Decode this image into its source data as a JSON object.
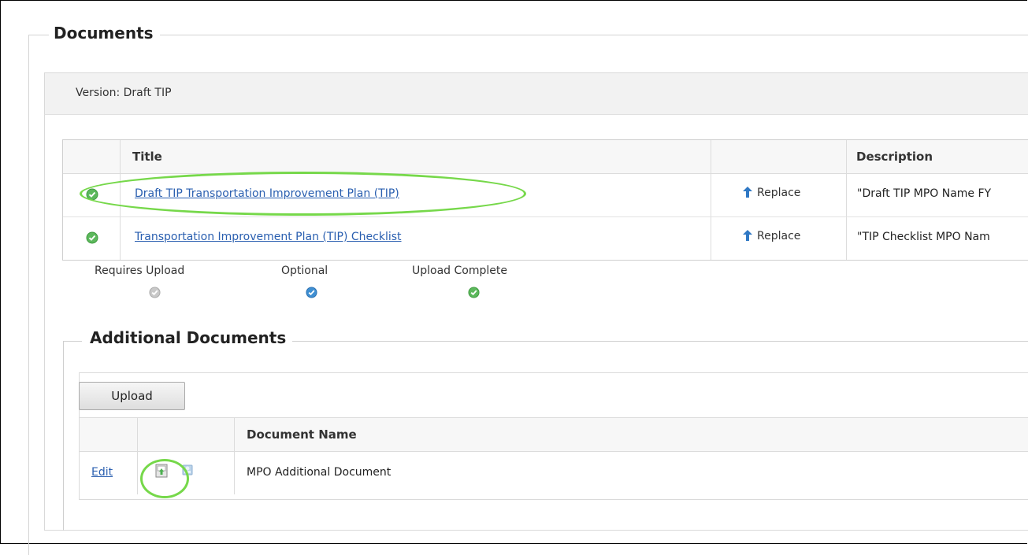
{
  "documents": {
    "legend": "Documents",
    "version_text": "Version: Draft TIP",
    "table": {
      "headers": {
        "title": "Title",
        "action": "",
        "description": "Description"
      },
      "rows": [
        {
          "status": "upload-complete",
          "title": "Draft TIP Transportation Improvement Plan (TIP)",
          "action": "Replace",
          "description": "\"Draft TIP MPO Name FY"
        },
        {
          "status": "upload-complete",
          "title": "Transportation Improvement Plan (TIP) Checklist",
          "action": "Replace",
          "description": "\"TIP Checklist MPO Nam"
        }
      ]
    },
    "status_legend": [
      {
        "label": "Requires Upload",
        "color": "#bdbdbd",
        "icon": "grey-check-icon"
      },
      {
        "label": "Optional",
        "color": "#3f8fd2",
        "icon": "blue-check-icon"
      },
      {
        "label": "Upload Complete",
        "color": "#5cb85c",
        "icon": "green-check-icon"
      }
    ]
  },
  "additional": {
    "legend": "Additional Documents",
    "upload_label": "Upload",
    "headers": {
      "col1": "",
      "col2": "",
      "name": "Document Name"
    },
    "rows": [
      {
        "edit": "Edit",
        "name": "MPO Additional Document"
      }
    ]
  },
  "colors": {
    "link": "#2a5fb0",
    "highlight": "#76d84a",
    "complete": "#5cb85c",
    "optional": "#3f8fd2",
    "required": "#bdbdbd"
  }
}
